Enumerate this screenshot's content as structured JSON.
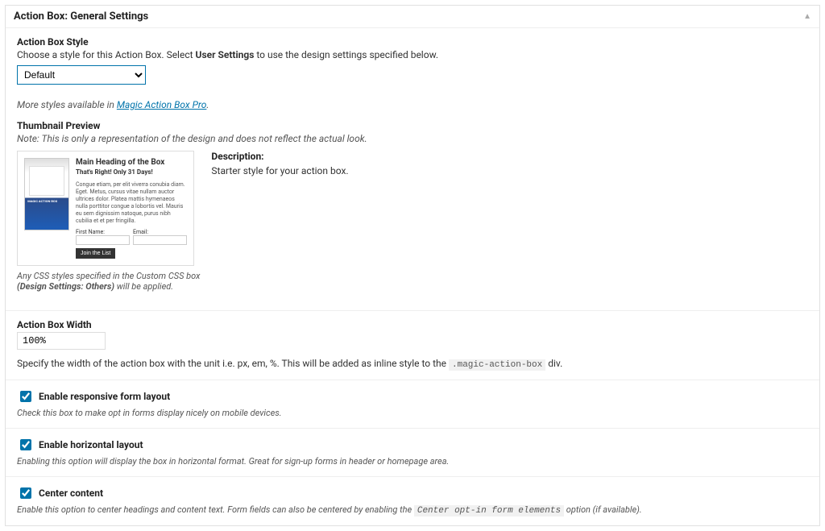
{
  "header": {
    "title": "Action Box: General Settings"
  },
  "style_section": {
    "heading": "Action Box Style",
    "instruction_pre": "Choose a style for this Action Box. Select ",
    "instruction_bold": "User Settings",
    "instruction_post": " to use the design settings specified below.",
    "select_value": "Default",
    "more_pre": "More styles available in ",
    "more_link": "Magic Action Box Pro",
    "more_post": "."
  },
  "thumbnail": {
    "heading": "Thumbnail Preview",
    "note": "Note: This is only a representation of the design and does not reflect the actual look.",
    "sample": {
      "heading": "Main Heading of the Box",
      "sub": "That's Right! Only 31 Days!",
      "lorem": "Congue etiam, per elit viverra conubia diam. Eget. Metus, cursus vitae nullam auctor ultrices dolor. Platea mattis hymenaeos nulla porttitor congue a lobortis vel. Mauris eu sem dignissim natoque, purus nibh cubilia et et per fringilla.",
      "first_name_label": "First Name:",
      "email_label": "Email:",
      "button": "Join the List"
    },
    "css_note_line1": "Any CSS styles specified in the Custom CSS box",
    "css_note_line2_bold": "(Design Settings: Others)",
    "css_note_line2_rest": " will be applied.",
    "description_heading": "Description:",
    "description_text": "Starter style for your action box."
  },
  "width_section": {
    "heading": "Action Box Width",
    "value": "100%",
    "desc_pre": "Specify the width of the action box with the unit i.e. px, em, %. This will be added as inline style to the ",
    "desc_code": ".magic-action-box",
    "desc_post": " div."
  },
  "responsive": {
    "label": "Enable responsive form layout",
    "desc": "Check this box to make opt in forms display nicely on mobile devices."
  },
  "horizontal": {
    "label": "Enable horizontal layout",
    "desc": "Enabling this option will display the box in horizontal format. Great for sign-up forms in header or homepage area."
  },
  "center": {
    "label": "Center content",
    "desc_pre": "Enable this option to center headings and content text. Form fields can also be centered by enabling the ",
    "desc_code": "Center opt-in form elements",
    "desc_post": " option (if available)."
  }
}
